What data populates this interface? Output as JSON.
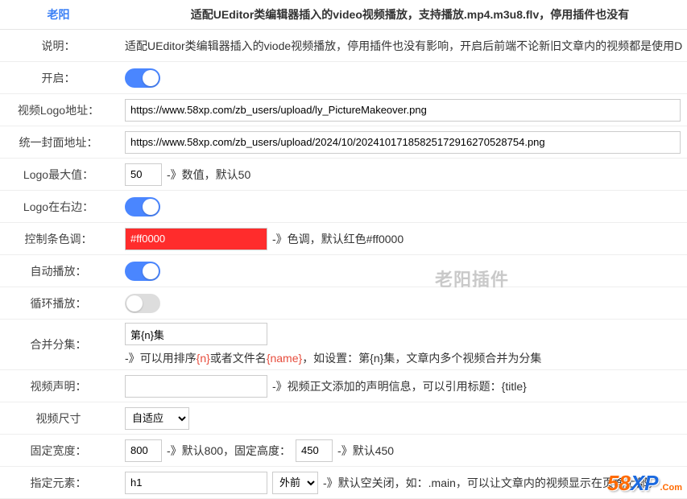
{
  "brand": "老阳",
  "title": "适配UEditor类编辑器插入的video视频播放，支持播放.mp4.m3u8.flv，停用插件也没有",
  "watermark": "老阳插件",
  "rows": {
    "desc": {
      "label": "说明：",
      "text": "适配UEditor类编辑器插入的viode视频播放，停用插件也没有影响，开启后前端不论新旧文章内的视频都是使用D"
    },
    "enable": {
      "label": "开启：",
      "on": true
    },
    "logoUrl": {
      "label": "视频Logo地址：",
      "value": "https://www.58xp.com/zb_users/upload/ly_PictureMakeover.png"
    },
    "uniCover": {
      "label": "统一封面地址：",
      "value": "https://www.58xp.com/zb_users/upload/2024/10/202410171858251729162705287​54.png"
    },
    "logoMax": {
      "label": "Logo最大值：",
      "value": "50",
      "hint": "-》数值，默认50"
    },
    "logoRight": {
      "label": "Logo在右边：",
      "on": true
    },
    "controlColor": {
      "label": "控制条色调：",
      "value": "#ff0000",
      "hint": "-》色调，默认红色#ff0000",
      "bg": "#ff2c2c"
    },
    "autoplay": {
      "label": "自动播放：",
      "on": true
    },
    "loop": {
      "label": "循环播放：",
      "on": false
    },
    "mergeEp": {
      "label": "合并分集：",
      "value": "第{n}集",
      "hintPrefix": "-》可以用排序",
      "n": "{n}",
      "hintMid": "或者文件名",
      "name": "{name}",
      "hintSuffix": "，如设置：第{n}集，文章内多个视频合并为分集"
    },
    "stmt": {
      "label": "视频声明：",
      "value": "",
      "hint": "-》视频正文添加的声明信息，可以引用标题：{title}"
    },
    "size": {
      "label": "视频尺寸",
      "options": [
        "自适应"
      ],
      "value": "自适应"
    },
    "fixedW": {
      "label": "固定宽度：",
      "w": "800",
      "wHint": "-》默认800，固定高度：",
      "h": "450",
      "hHint": "-》默认450"
    },
    "elem": {
      "label": "指定元素：",
      "value": "h1",
      "selOptions": [
        "外前"
      ],
      "selValue": "外前",
      "hint": "-》默认空关闭，如：.main，可以让文章内的视频显示在页面上部。"
    }
  },
  "logo58xp": {
    "a": "58",
    "b": "XP",
    "c": ".Com"
  }
}
